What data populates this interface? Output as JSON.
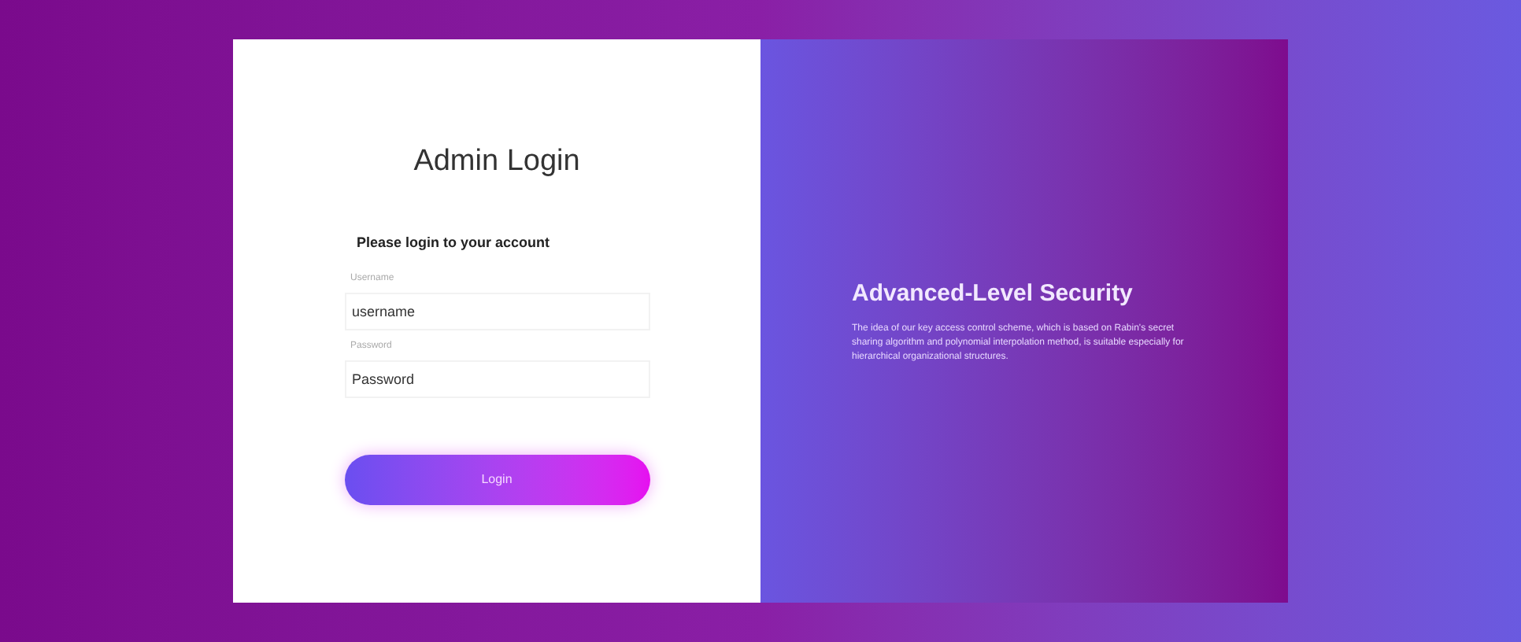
{
  "login": {
    "title": "Admin Login",
    "subtitle": "Please login to your account",
    "fields": [
      {
        "label": "Username",
        "value": "username"
      },
      {
        "label": "Password",
        "value": "Password"
      }
    ],
    "button": "Login"
  },
  "info": {
    "title": "Advanced-Level Security",
    "text": "The idea of our key access control scheme, which is based on Rabin's secret sharing algorithm and polynomial interpolation method, is suitable especially for hierarchical organizational structures."
  }
}
